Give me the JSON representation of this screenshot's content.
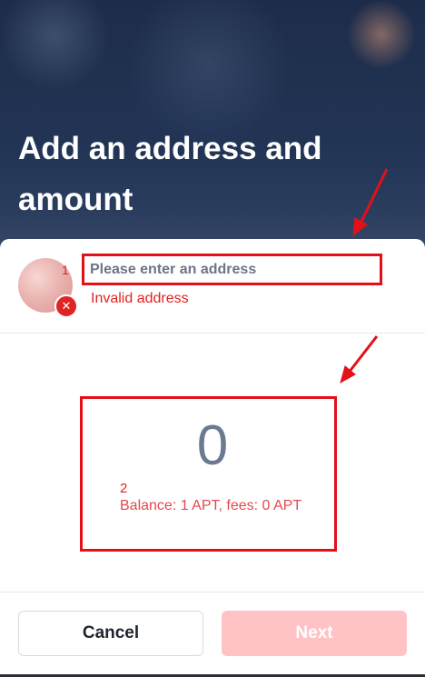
{
  "header": {
    "title": "Add an address and amount"
  },
  "recipient": {
    "address_placeholder": "Please enter an address",
    "address_value": "",
    "error_text": "Invalid address",
    "error_icon": "close-icon"
  },
  "annotations": {
    "marker_1": "1",
    "marker_2": "2"
  },
  "amount": {
    "value": "0",
    "balance_text": "Balance: 1 APT, fees: 0 APT"
  },
  "actions": {
    "cancel_label": "Cancel",
    "next_label": "Next"
  },
  "colors": {
    "error": "#e02424",
    "next_disabled": "#ffc2c5",
    "amount_text": "#6b7a91",
    "hero_bg": "#1d2c49"
  }
}
